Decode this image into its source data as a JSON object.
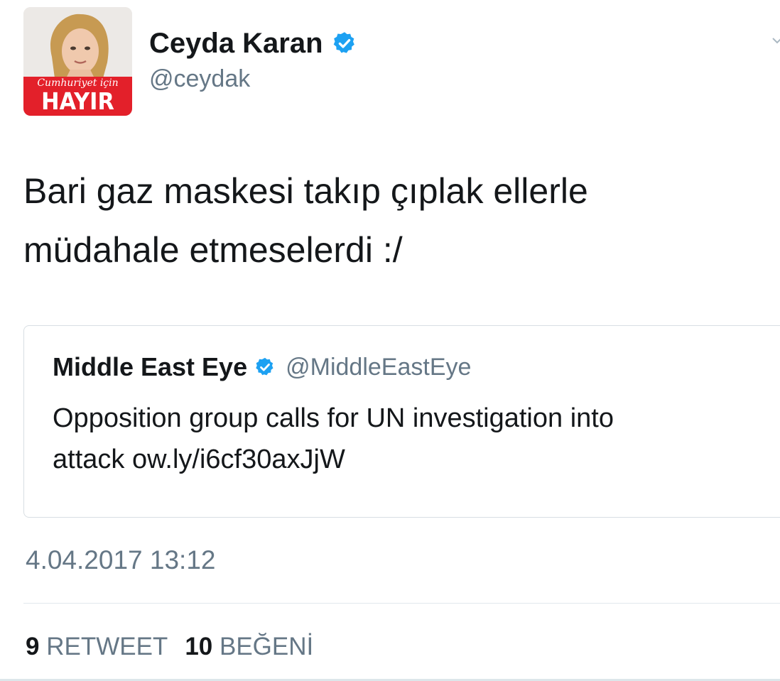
{
  "author": {
    "display_name": "Ceyda Karan",
    "handle": "@ceydak",
    "avatar_caption_script": "Cumhuriyet için",
    "avatar_caption_big": "HAYIR",
    "verified_icon": "verified-badge-icon"
  },
  "tweet": {
    "text_line1": "Bari gaz maskesi takıp çıplak ellerle",
    "text_line2": "müdahale etmeselerdi :/"
  },
  "quoted_tweet": {
    "display_name": "Middle East Eye",
    "handle": "@MiddleEastEye",
    "text_line1": "Opposition group calls for UN investigation into",
    "text_line2": "attack ow.ly/i6cf30axJjW"
  },
  "timestamp": "4.04.2017 13:12",
  "stats": {
    "retweets_count": "9",
    "retweets_label": "RETWEET",
    "likes_count": "10",
    "likes_label": "BEĞENİ"
  },
  "colors": {
    "verified": "#1da1f2",
    "avatar_banner": "#e3202a",
    "secondary_text": "#657786"
  }
}
